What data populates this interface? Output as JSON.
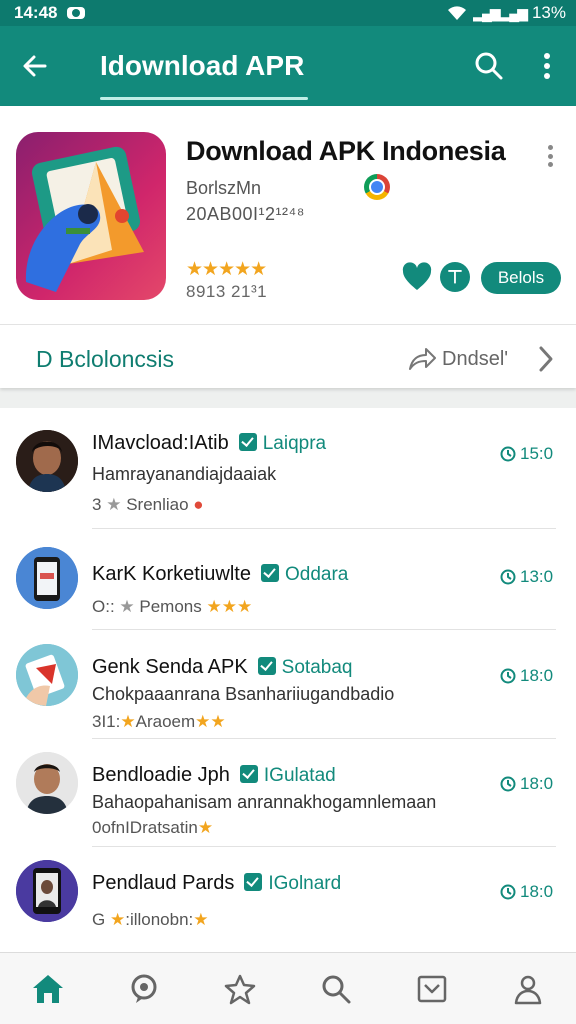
{
  "status_bar": {
    "time": "14:48",
    "battery": "13%"
  },
  "app_bar": {
    "title": "Idownload APR"
  },
  "app": {
    "name": "Download APK Indonesia",
    "developer": "BorlszMn",
    "build": "20AB00I¹2¹²⁴⁸",
    "rating_stars": "★★★★★",
    "rating_count": "8913 21³1",
    "action_label": "Belols"
  },
  "section": {
    "title": "D Bcloloncsis",
    "link_label": "Dndsel'"
  },
  "list": [
    {
      "title": "IMavcload:IAtib",
      "tag": "Laiqpra",
      "desc": "Hamrayanandiajdaaiak",
      "meta_prefix": "3",
      "meta_text": "Srenliao",
      "time": "15:0"
    },
    {
      "title": "KarK Korketiuwlte",
      "tag": "Oddara",
      "desc": "",
      "meta_prefix": "O::",
      "meta_text": "Pemons",
      "time": "13:0"
    },
    {
      "title": "Genk Senda APK",
      "tag": "Sotabaq",
      "desc": "Chokpaaanrana Bsanhariiugandbadio",
      "meta_prefix": "3I1:",
      "meta_text": "Araoem",
      "time": "18:0"
    },
    {
      "title": "Bendloadie Jph",
      "tag": "IGulatad",
      "desc": "Bahaopahanisam anrannakhogamnlemaan",
      "meta_prefix": "0",
      "meta_text": "0ofnIDratsatin",
      "time": "18:0"
    },
    {
      "title": "Pendlaud Pards",
      "tag": "IGolnard",
      "desc": "",
      "meta_prefix": "G",
      "meta_text": ":illonobn:",
      "time": "18:0"
    }
  ],
  "colors": {
    "primary": "#128a7c",
    "status": "#0d7a6e",
    "star": "#f2a51f"
  },
  "icons": [
    "back-icon",
    "search-icon",
    "more-vert-icon",
    "chrome-icon",
    "heart-icon",
    "share-icon",
    "send-icon",
    "chevron-right-icon",
    "home-icon",
    "chat-icon",
    "star-icon",
    "search-nav-icon",
    "inbox-icon",
    "profile-icon"
  ]
}
